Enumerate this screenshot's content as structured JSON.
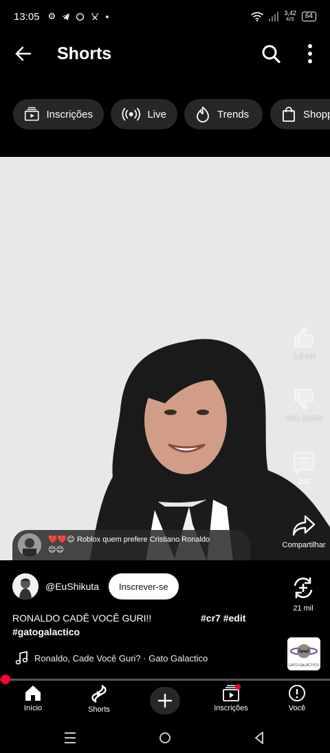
{
  "status_bar": {
    "time": "13:05",
    "notif_icons": [
      "settings-icon",
      "telegram-icon",
      "whatsapp-icon",
      "alarm-icon",
      "dot-icon"
    ],
    "net_speed_value": "3,42",
    "net_speed_unit": "K/S",
    "battery": "64"
  },
  "header": {
    "title": "Shorts"
  },
  "chips": [
    {
      "label": "Inscrições",
      "icon": "subscriptions-icon"
    },
    {
      "label": "Live",
      "icon": "live-icon"
    },
    {
      "label": "Trends",
      "icon": "trends-icon"
    },
    {
      "label": "Shopp",
      "icon": "shopping-icon"
    }
  ],
  "actions": {
    "like_count": "1,9 mil",
    "dislike_label": "Não gostei",
    "comments_count": "102",
    "share_label": "Compartilhar",
    "remix_count": "21 mil"
  },
  "comment_preview": {
    "emojis": "❤️❤️😊",
    "text": "Roblox quem prefere Cristiano Ronaldo",
    "emojis2": "😊😊"
  },
  "channel": {
    "name": "@EuShikuta",
    "subscribe_label": "Inscrever-se"
  },
  "caption": {
    "text": "RONALDO CADÊ VOCÊ GURI!!",
    "tag1": "#cr7 #edit",
    "tag2": "#gatogalactico"
  },
  "sound": {
    "label": "Ronaldo, Cade Você Guri? · Gato Galactico",
    "thumb_text": "GATO GALÁCTICO"
  },
  "progress": 0.01,
  "nav": [
    {
      "label": "Início",
      "icon": "home-icon"
    },
    {
      "label": "Shorts",
      "icon": "shorts-icon"
    },
    {
      "label": "Inscrições",
      "icon": "subscriptions-icon"
    },
    {
      "label": "Você",
      "icon": "you-icon"
    }
  ],
  "colors": {
    "accent": "#ff0033",
    "chip_bg": "#272727",
    "video_bg": "#e8e8e8"
  }
}
